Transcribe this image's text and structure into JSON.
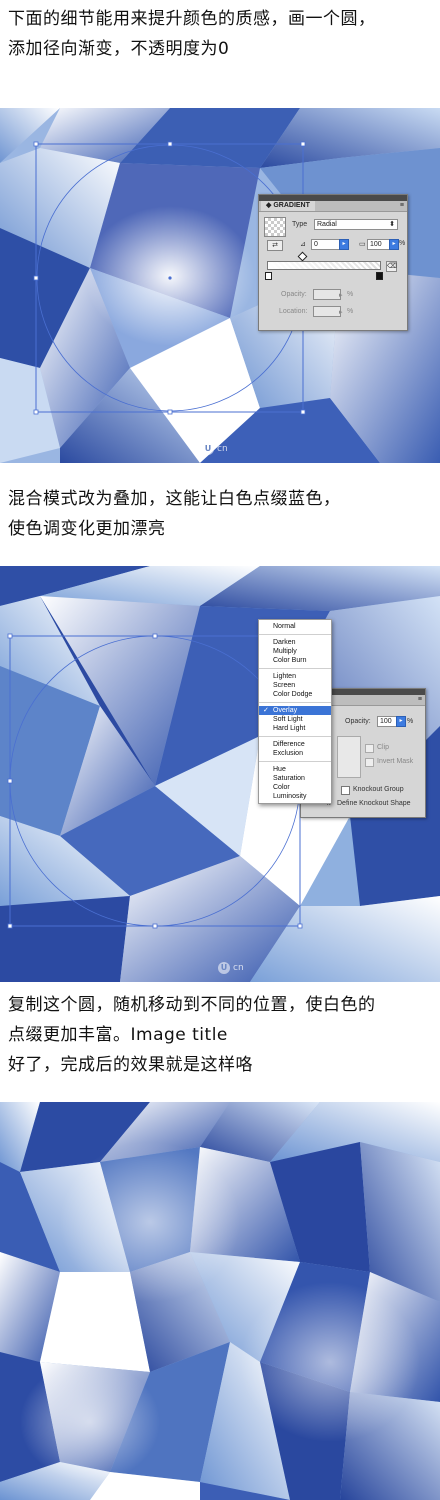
{
  "text": {
    "p1": [
      "下面的细节能用来提升颜色的质感，画一个圆，",
      "添加径向渐变，不透明度为0"
    ],
    "p2": [
      "混合模式改为叠加，这能让白色点缀蓝色，",
      "使色调变化更加漂亮"
    ],
    "p3": [
      "复制这个圆，随机移动到不同的位置，使白色的",
      "点缀更加丰富。Image title",
      "好了，完成后的效果就是这样咯"
    ]
  },
  "watermark": "cn",
  "gradient_panel": {
    "title": "GRADIENT",
    "menu_icon": "≡",
    "type_label": "Type",
    "type_value": "Radial",
    "angle_value": "0",
    "aspect_value": "100",
    "percent_sign": "%",
    "opacity_label": "Opacity:",
    "location_label": "Location:"
  },
  "transparency_panel": {
    "opacity_label": "Opacity:",
    "opacity_value": "100",
    "clip_label": "Clip",
    "invert_mask_label": "Invert Mask",
    "knockout_group_label": "Knockout Group",
    "define_knockout_label": "Define Knockout Shape",
    "isolate_fragment": "g",
    "define_fragment_prefix": "k"
  },
  "blend_menu": {
    "groups": [
      [
        "Normal"
      ],
      [
        "Darken",
        "Multiply",
        "Color Burn"
      ],
      [
        "Lighten",
        "Screen",
        "Color Dodge"
      ],
      [
        "Overlay",
        "Soft Light",
        "Hard Light"
      ],
      [
        "Difference",
        "Exclusion"
      ],
      [
        "Hue",
        "Saturation",
        "Color",
        "Luminosity"
      ]
    ],
    "selected": "Overlay"
  },
  "colors": {
    "deep_blue": "#2b4aa0",
    "mid_blue": "#5f88cc",
    "light_blue": "#b6cdee",
    "white": "#ffffff",
    "selection": "#4a6fd1"
  }
}
